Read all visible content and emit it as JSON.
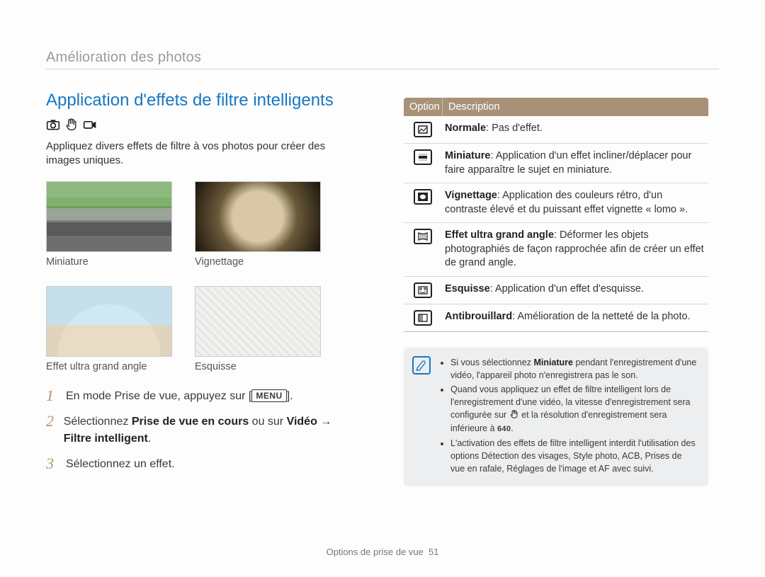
{
  "breadcrumb": "Amélioration des photos",
  "title": "Application d'effets de filtre intelligents",
  "mode_icons": [
    "camera-icon",
    "dis-hand-icon",
    "video-icon"
  ],
  "intro": "Appliquez divers effets de filtre à vos photos pour créer des images uniques.",
  "thumbs": [
    {
      "name": "miniature",
      "label": "Miniature"
    },
    {
      "name": "vignettage",
      "label": "Vignettage"
    },
    {
      "name": "wide",
      "label": "Effet ultra grand angle"
    },
    {
      "name": "esquisse",
      "label": "Esquisse"
    }
  ],
  "steps": {
    "s1_a": "En mode Prise de vue, appuyez sur [",
    "s1_menu": "MENU",
    "s1_b": "].",
    "s2_a": "Sélectionnez ",
    "s2_b": "Prise de vue en cours",
    "s2_c": " ou sur ",
    "s2_d": "Vidéo",
    "s2_e": " → ",
    "s2_f": "Filtre intelligent",
    "s2_g": ".",
    "s3": "Sélectionnez un effet."
  },
  "table": {
    "head_option": "Option",
    "head_desc": "Description",
    "rows": [
      {
        "icon": "normal",
        "term": "Normale",
        "text": ": Pas d'effet."
      },
      {
        "icon": "miniature",
        "term": "Miniature",
        "text": ": Application d'un effet incliner/déplacer pour faire apparaître le sujet en miniature."
      },
      {
        "icon": "vignette",
        "term": "Vignettage",
        "text": ": Application des couleurs rétro, d'un contraste élevé et du puissant effet vignette « lomo »."
      },
      {
        "icon": "wide",
        "term": "Effet ultra grand angle",
        "text": ": Déformer les objets photographiés de façon rapprochée afin de créer un effet de grand angle."
      },
      {
        "icon": "sketch",
        "term": "Esquisse",
        "text": ": Application d'un effet d'esquisse."
      },
      {
        "icon": "defog",
        "term": "Antibrouillard",
        "text": ": Amélioration de la netteté de la photo."
      }
    ]
  },
  "note_lines": {
    "l1_a": "Si vous sélectionnez ",
    "l1_b": "Miniature",
    "l1_c": " pendant l'enregistrement d'une vidéo, l'appareil photo n'enregistrera pas le son.",
    "l2_a": "Quand vous appliquez un effet de filtre intelligent lors de l'enregistrement d'une vidéo, la vitesse d'enregistrement sera configurée sur ",
    "l2_b": " et la résolution d'enregistrement sera inférieure à ",
    "l2_res": "640",
    "l2_c": ".",
    "l3": "L'activation des effets de filtre intelligent interdit l'utilisation des options Détection des visages, Style photo, ACB, Prises de vue en rafale, Réglages de l'image et AF avec suivi."
  },
  "footer_a": "Options de prise de vue",
  "footer_page": "51"
}
